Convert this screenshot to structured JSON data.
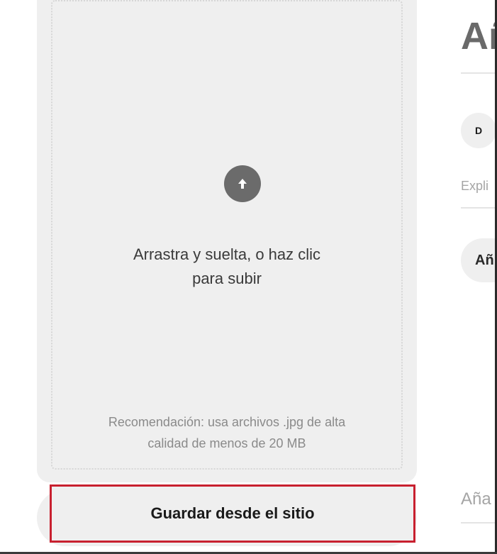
{
  "upload": {
    "drop_line1": "Arrastra y suelta, o haz clic",
    "drop_line2": "para subir",
    "hint_line1": "Recomendación: usa archivos .jpg de alta",
    "hint_line2": "calidad de menos de 20 MB",
    "icon": "arrow-up-icon"
  },
  "save_site": {
    "label": "Guardar desde el sitio",
    "highlight_color": "#c8202f"
  },
  "form": {
    "title_partial": "Añ",
    "avatar_initial": "D",
    "description_placeholder_partial": "Expli",
    "add_chip_partial": "Añ",
    "bottom_field_partial": "Aña"
  }
}
